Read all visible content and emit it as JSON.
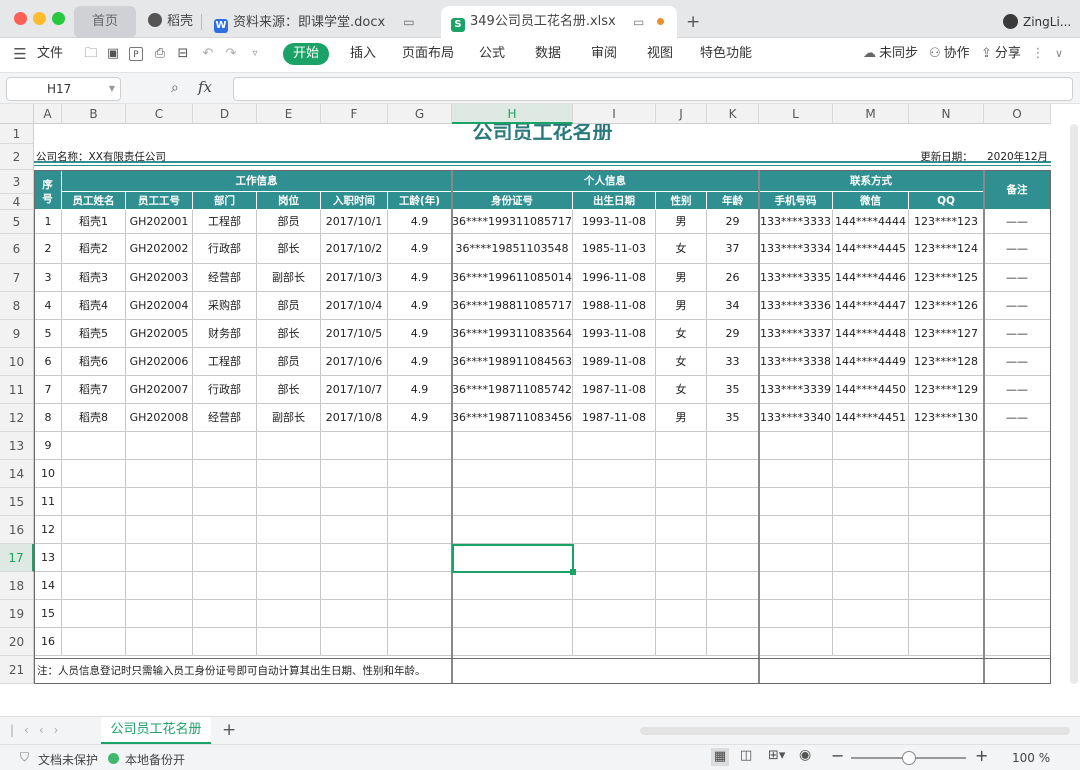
{
  "window": {
    "tabs": [
      {
        "label": "首页"
      },
      {
        "label": "稻壳"
      },
      {
        "label": "资料来源：即课学堂.docx"
      },
      {
        "label": "349公司员工花名册.xlsx"
      }
    ],
    "user": "ZingLi...",
    "new_tab_symbol": "+"
  },
  "menu": {
    "file": "文件",
    "start": "开始",
    "items": [
      "插入",
      "页面布局",
      "公式",
      "数据",
      "审阅",
      "视图",
      "特色功能"
    ],
    "sync": "未同步",
    "collab": "协作",
    "share": "分享"
  },
  "formula": {
    "cell_ref": "H17",
    "fx": "fx",
    "value": ""
  },
  "columns": [
    "A",
    "B",
    "C",
    "D",
    "E",
    "F",
    "G",
    "H",
    "I",
    "J",
    "K",
    "L",
    "M",
    "N",
    "O"
  ],
  "rows": [
    "1",
    "2",
    "3",
    "4",
    "5",
    "6",
    "7",
    "8",
    "9",
    "10",
    "11",
    "12",
    "13",
    "14",
    "15",
    "16",
    "17",
    "18",
    "19",
    "20",
    "21"
  ],
  "sheet": {
    "title": "公司员工花名册",
    "company": "公司名称：XX有限责任公司",
    "update_label": "更新日期：",
    "update_value": "2020年12月",
    "seq_header": "序号",
    "groups": {
      "work": "工作信息",
      "personal": "个人信息",
      "contact": "联系方式",
      "remark": "备注"
    },
    "headers": [
      "员工姓名",
      "员工工号",
      "部门",
      "岗位",
      "入职时间",
      "工龄(年)",
      "身份证号",
      "出生日期",
      "性别",
      "年龄",
      "手机号码",
      "微信",
      "QQ"
    ],
    "data": [
      {
        "no": "1",
        "name": "稻壳1",
        "id": "GH202001",
        "dept": "工程部",
        "pos": "部员",
        "date": "2017/10/1",
        "years": "4.9",
        "card": "36****199311085717",
        "birth": "1993-11-08",
        "sex": "男",
        "age": "29",
        "phone": "133****3333",
        "wechat": "144****4444",
        "qq": "123****123",
        "remark": "——"
      },
      {
        "no": "2",
        "name": "稻壳2",
        "id": "GH202002",
        "dept": "行政部",
        "pos": "部长",
        "date": "2017/10/2",
        "years": "4.9",
        "card": "36****19851103548",
        "birth": "1985-11-03",
        "sex": "女",
        "age": "37",
        "phone": "133****3334",
        "wechat": "144****4445",
        "qq": "123****124",
        "remark": "——"
      },
      {
        "no": "3",
        "name": "稻壳3",
        "id": "GH202003",
        "dept": "经营部",
        "pos": "副部长",
        "date": "2017/10/3",
        "years": "4.9",
        "card": "36****199611085014",
        "birth": "1996-11-08",
        "sex": "男",
        "age": "26",
        "phone": "133****3335",
        "wechat": "144****4446",
        "qq": "123****125",
        "remark": "——"
      },
      {
        "no": "4",
        "name": "稻壳4",
        "id": "GH202004",
        "dept": "采购部",
        "pos": "部员",
        "date": "2017/10/4",
        "years": "4.9",
        "card": "36****198811085717",
        "birth": "1988-11-08",
        "sex": "男",
        "age": "34",
        "phone": "133****3336",
        "wechat": "144****4447",
        "qq": "123****126",
        "remark": "——"
      },
      {
        "no": "5",
        "name": "稻壳5",
        "id": "GH202005",
        "dept": "财务部",
        "pos": "部长",
        "date": "2017/10/5",
        "years": "4.9",
        "card": "36****199311083564",
        "birth": "1993-11-08",
        "sex": "女",
        "age": "29",
        "phone": "133****3337",
        "wechat": "144****4448",
        "qq": "123****127",
        "remark": "——"
      },
      {
        "no": "6",
        "name": "稻壳6",
        "id": "GH202006",
        "dept": "工程部",
        "pos": "部员",
        "date": "2017/10/6",
        "years": "4.9",
        "card": "36****198911084563",
        "birth": "1989-11-08",
        "sex": "女",
        "age": "33",
        "phone": "133****3338",
        "wechat": "144****4449",
        "qq": "123****128",
        "remark": "——"
      },
      {
        "no": "7",
        "name": "稻壳7",
        "id": "GH202007",
        "dept": "行政部",
        "pos": "部长",
        "date": "2017/10/7",
        "years": "4.9",
        "card": "36****198711085742",
        "birth": "1987-11-08",
        "sex": "女",
        "age": "35",
        "phone": "133****3339",
        "wechat": "144****4450",
        "qq": "123****129",
        "remark": "——"
      },
      {
        "no": "8",
        "name": "稻壳8",
        "id": "GH202008",
        "dept": "经营部",
        "pos": "副部长",
        "date": "2017/10/8",
        "years": "4.9",
        "card": "36****198711083456",
        "birth": "1987-11-08",
        "sex": "男",
        "age": "35",
        "phone": "133****3340",
        "wechat": "144****4451",
        "qq": "123****130",
        "remark": "——"
      }
    ],
    "empty_nos": [
      "9",
      "10",
      "11",
      "12",
      "13",
      "14",
      "15",
      "16"
    ],
    "note": "注：人员信息登记时只需输入员工身份证号即可自动计算其出生日期、性别和年龄。"
  },
  "sheet_tabs": {
    "active": "公司员工花名册",
    "add": "+"
  },
  "status": {
    "protect": "文档未保护",
    "backup": "本地备份开",
    "zoom": "100 %"
  },
  "colors": {
    "accent": "#1aa267",
    "header_teal": "#2f8f91",
    "title_teal": "#2a7a7c"
  },
  "icons": [
    "close",
    "minimize",
    "maximize",
    "menu-hamburger",
    "open-folder",
    "save",
    "pdf",
    "print",
    "undo",
    "redo",
    "sync-cloud",
    "collab-user",
    "share",
    "zoom-search",
    "fx",
    "shield",
    "backup-dot",
    "grid-view",
    "page-view",
    "split-view",
    "eye",
    "zoom-minus",
    "zoom-plus"
  ]
}
